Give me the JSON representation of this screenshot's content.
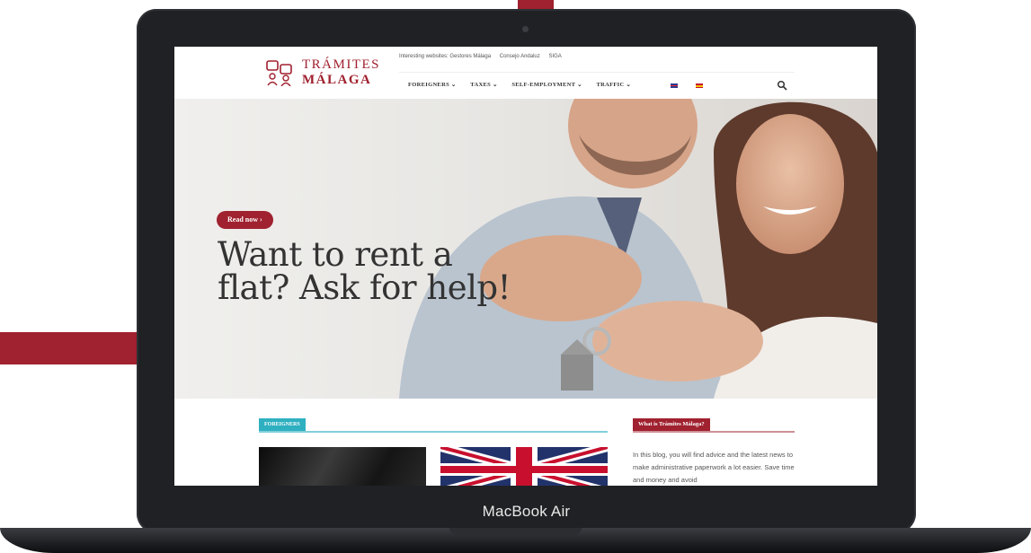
{
  "device": {
    "label": "MacBook Air"
  },
  "site": {
    "logo": {
      "line1": "TRÁMITES",
      "line2": "MÁLAGA"
    },
    "topbar": [
      "Interesting websites: Gestores Málaga",
      "Consejo Andaluz",
      "SIGA"
    ],
    "nav": [
      {
        "label": "FOREIGNERS",
        "has_dropdown": true
      },
      {
        "label": "TAXES",
        "has_dropdown": true
      },
      {
        "label": "SELF-EMPLOYMENT",
        "has_dropdown": true
      },
      {
        "label": "TRAFFIC",
        "has_dropdown": true
      }
    ],
    "languages": [
      "english-flag",
      "spanish-flag"
    ],
    "search_icon": "search-icon"
  },
  "hero": {
    "button_label": "Read now",
    "button_chevron": "›",
    "title": "Want to rent a flat? Ask for help!"
  },
  "content": {
    "category_badge": "FOREIGNERS",
    "sidebar": {
      "heading": "What is Trámites Málaga?",
      "text": "In this blog, you will find advice and the latest news to make administrative paperwork a lot easier. Save time and money and avoid"
    }
  },
  "colors": {
    "brand": "#a0212f",
    "accent_teal": "#2fb0c1",
    "text_dark": "#333333",
    "laptop_frame": "#1f2124"
  }
}
